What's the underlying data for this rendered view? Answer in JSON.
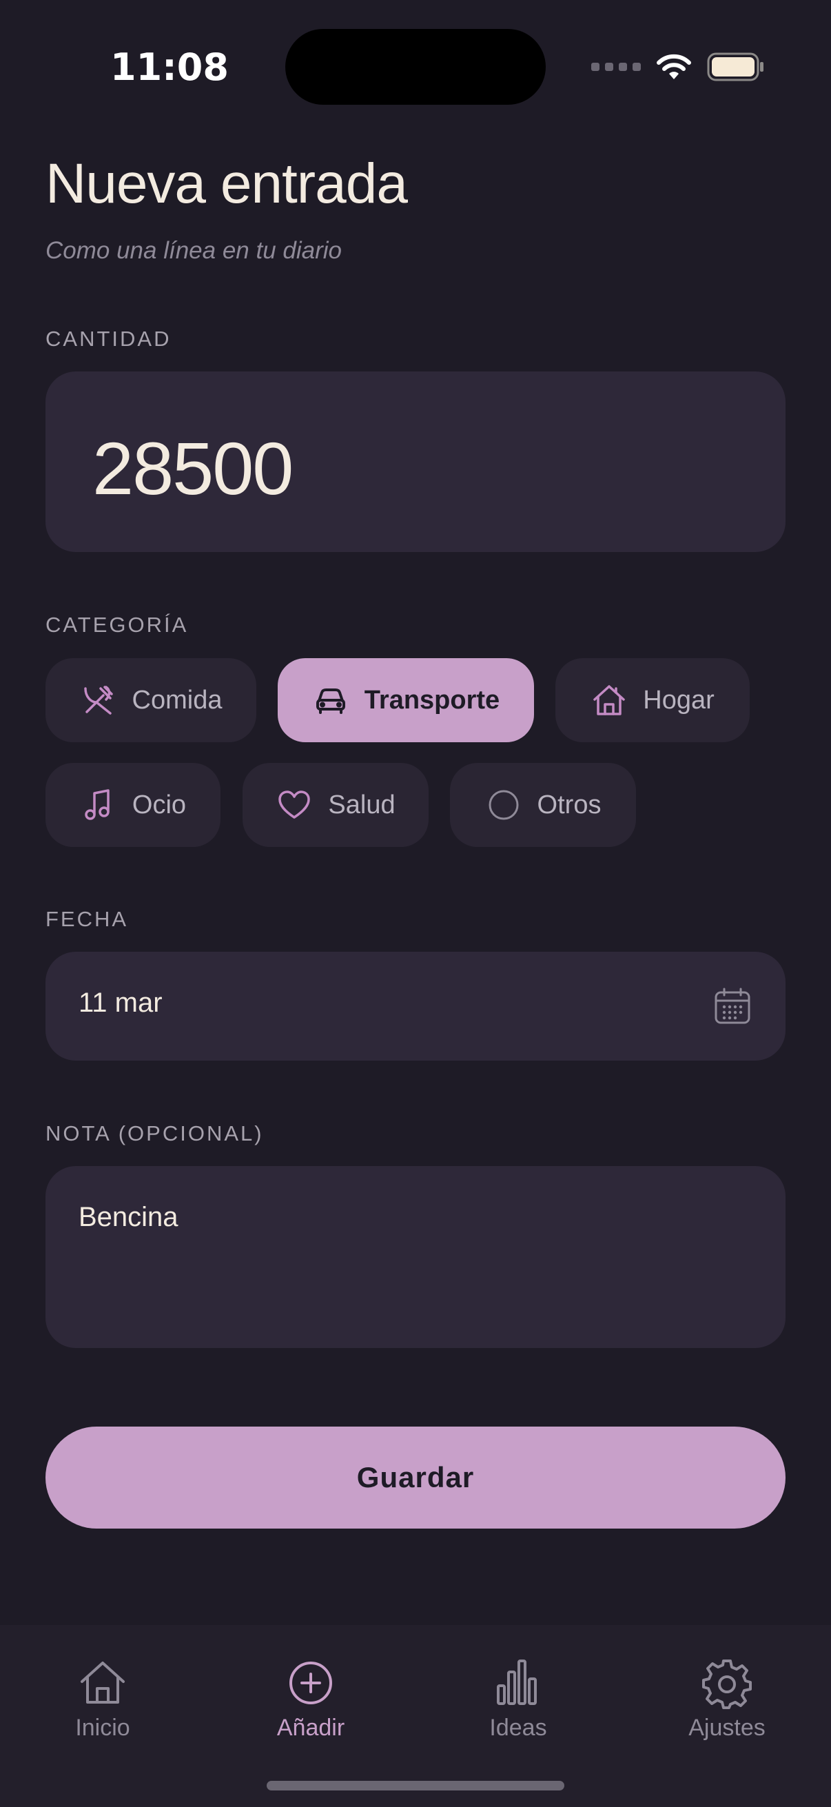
{
  "status_bar": {
    "time": "11:08"
  },
  "header": {
    "title": "Nueva entrada",
    "subtitle": "Como una línea en tu diario"
  },
  "amount": {
    "label": "CANTIDAD",
    "value": "28500"
  },
  "category": {
    "label": "CATEGORÍA",
    "selected": "Transporte",
    "options": [
      {
        "label": "Comida",
        "icon": "fork-knife-icon"
      },
      {
        "label": "Transporte",
        "icon": "car-icon"
      },
      {
        "label": "Hogar",
        "icon": "house-icon"
      },
      {
        "label": "Ocio",
        "icon": "music-note-icon"
      },
      {
        "label": "Salud",
        "icon": "heart-icon"
      },
      {
        "label": "Otros",
        "icon": "circle-icon"
      }
    ]
  },
  "date": {
    "label": "FECHA",
    "value": "11 mar"
  },
  "note": {
    "label": "NOTA (OPCIONAL)",
    "value": "Bencina"
  },
  "save_label": "Guardar",
  "tabs": [
    {
      "label": "Inicio",
      "icon": "home-icon",
      "active": false
    },
    {
      "label": "Añadir",
      "icon": "plus-circle-icon",
      "active": true
    },
    {
      "label": "Ideas",
      "icon": "bar-chart-icon",
      "active": false
    },
    {
      "label": "Ajustes",
      "icon": "gear-icon",
      "active": false
    }
  ],
  "colors": {
    "background": "#1e1b26",
    "card": "#2e2839",
    "accent": "#c8a0c9",
    "text": "#f3ebe0",
    "muted": "#8f8a98"
  }
}
